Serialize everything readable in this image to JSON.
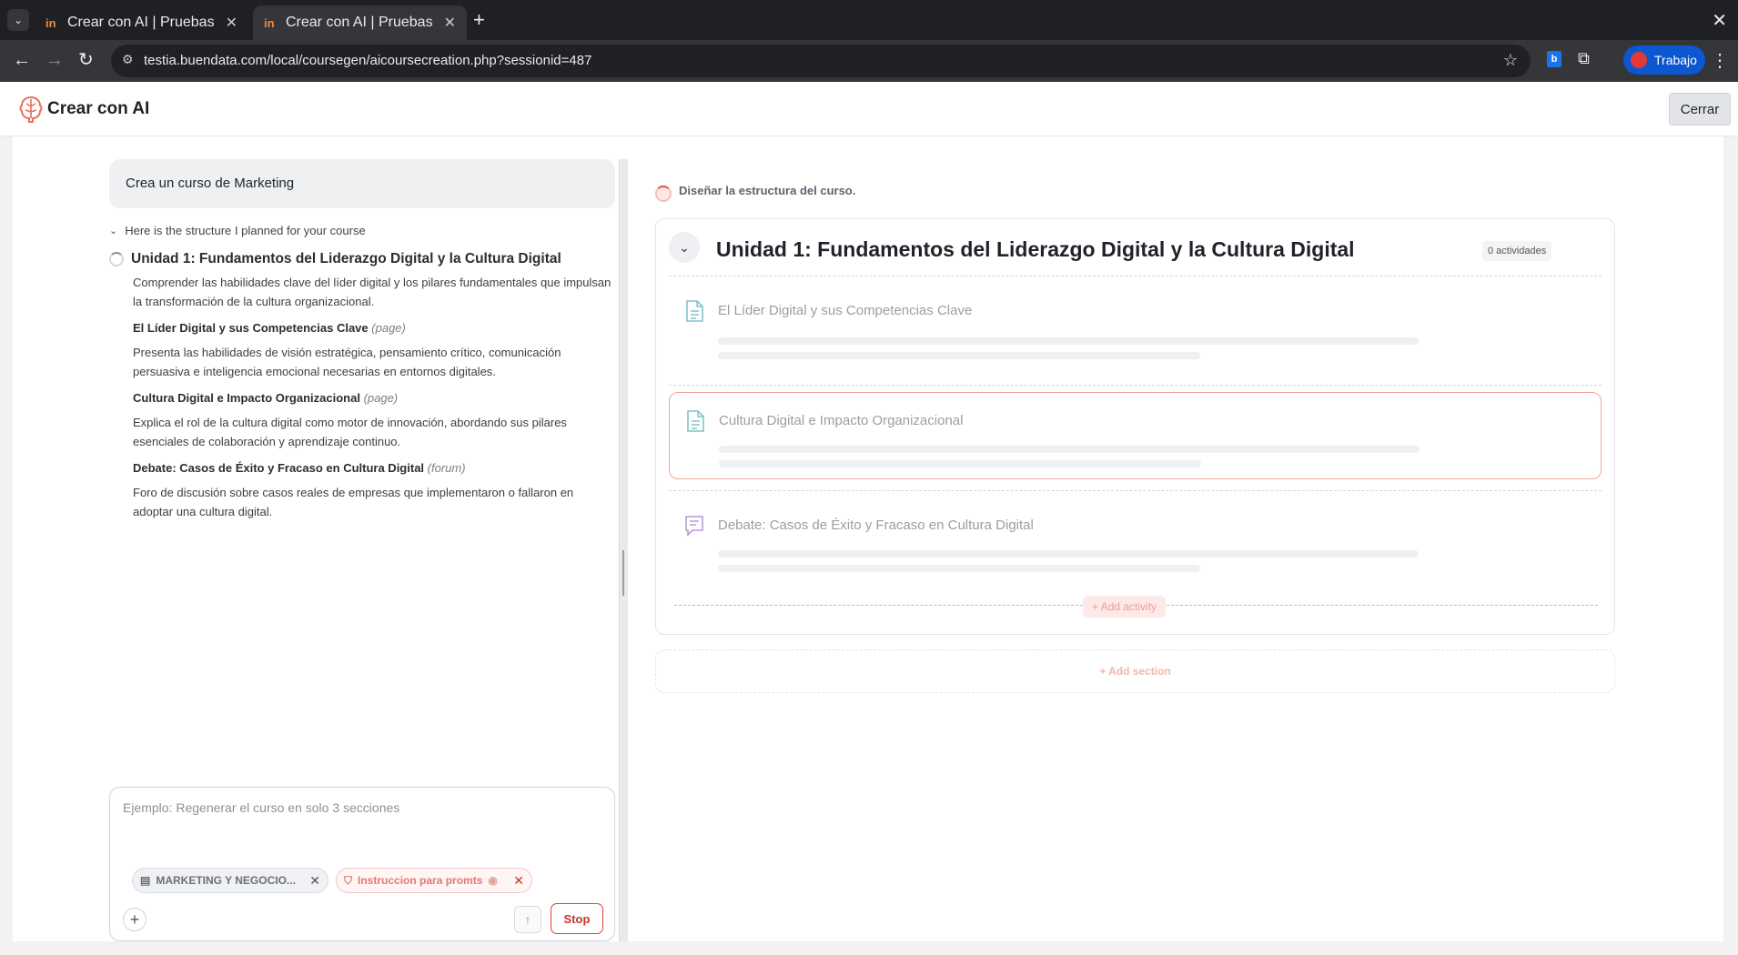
{
  "browser": {
    "tabs": [
      {
        "title": "Crear con AI | Pruebas Bu",
        "active": false
      },
      {
        "title": "Crear con AI | Pruebas Bu",
        "active": true
      }
    ],
    "url": "testia.buendata.com/local/coursegen/aicoursecreation.php?sessionid=487",
    "profile_label": "Trabajo",
    "ext_label": "b"
  },
  "app": {
    "title": "Crear con AI",
    "close_label": "Cerrar"
  },
  "chat": {
    "user_message": "Crea un curso de Marketing",
    "plan_toggle": "Here is the structure I planned for your course",
    "unit": {
      "title": "Unidad 1: Fundamentos del Liderazgo Digital y la Cultura Digital",
      "description": "Comprender las habilidades clave del líder digital y los pilares fundamentales que impulsan la transformación de la cultura organizacional.",
      "activities": [
        {
          "name": "El Líder Digital y sus Competencias Clave",
          "type": "(page)",
          "description": "Presenta las habilidades de visión estratégica, pensamiento crítico, comunicación persuasiva e inteligencia emocional necesarias en entornos digitales."
        },
        {
          "name": "Cultura Digital e Impacto Organizacional",
          "type": "(page)",
          "description": "Explica el rol de la cultura digital como motor de innovación, abordando sus pilares esenciales de colaboración y aprendizaje continuo."
        },
        {
          "name": "Debate: Casos de Éxito y Fracaso en Cultura Digital",
          "type": "(forum)",
          "description": "Foro de discusión sobre casos reales de empresas que implementaron o fallaron en adoptar una cultura digital."
        }
      ]
    },
    "composer": {
      "placeholder": "Ejemplo: Regenerar el curso en solo 3 secciones",
      "chip_category": "MARKETING Y NEGOCIO...",
      "chip_instruction": "Instruccion para promts",
      "stop_label": "Stop"
    }
  },
  "preview": {
    "status": "Diseñar la estructura del curso.",
    "section": {
      "title": "Unidad 1: Fundamentos del Liderazgo Digital y la Cultura Digital",
      "activity_count": "0 actividades",
      "activities": [
        {
          "title": "El Líder Digital y sus Competencias Clave",
          "icon": "page-icon",
          "highlighted": false
        },
        {
          "title": "Cultura Digital e Impacto Organizacional",
          "icon": "page-icon",
          "highlighted": true
        },
        {
          "title": "Debate: Casos de Éxito y Fracaso en Cultura Digital",
          "icon": "forum-icon",
          "highlighted": false
        }
      ],
      "add_activity_label": "+ Add activity"
    },
    "add_section_label": "+ Add section"
  },
  "colors": {
    "accent": "#e0554a",
    "page_icon": "#7fc4c8",
    "forum_icon": "#b59bd6"
  }
}
